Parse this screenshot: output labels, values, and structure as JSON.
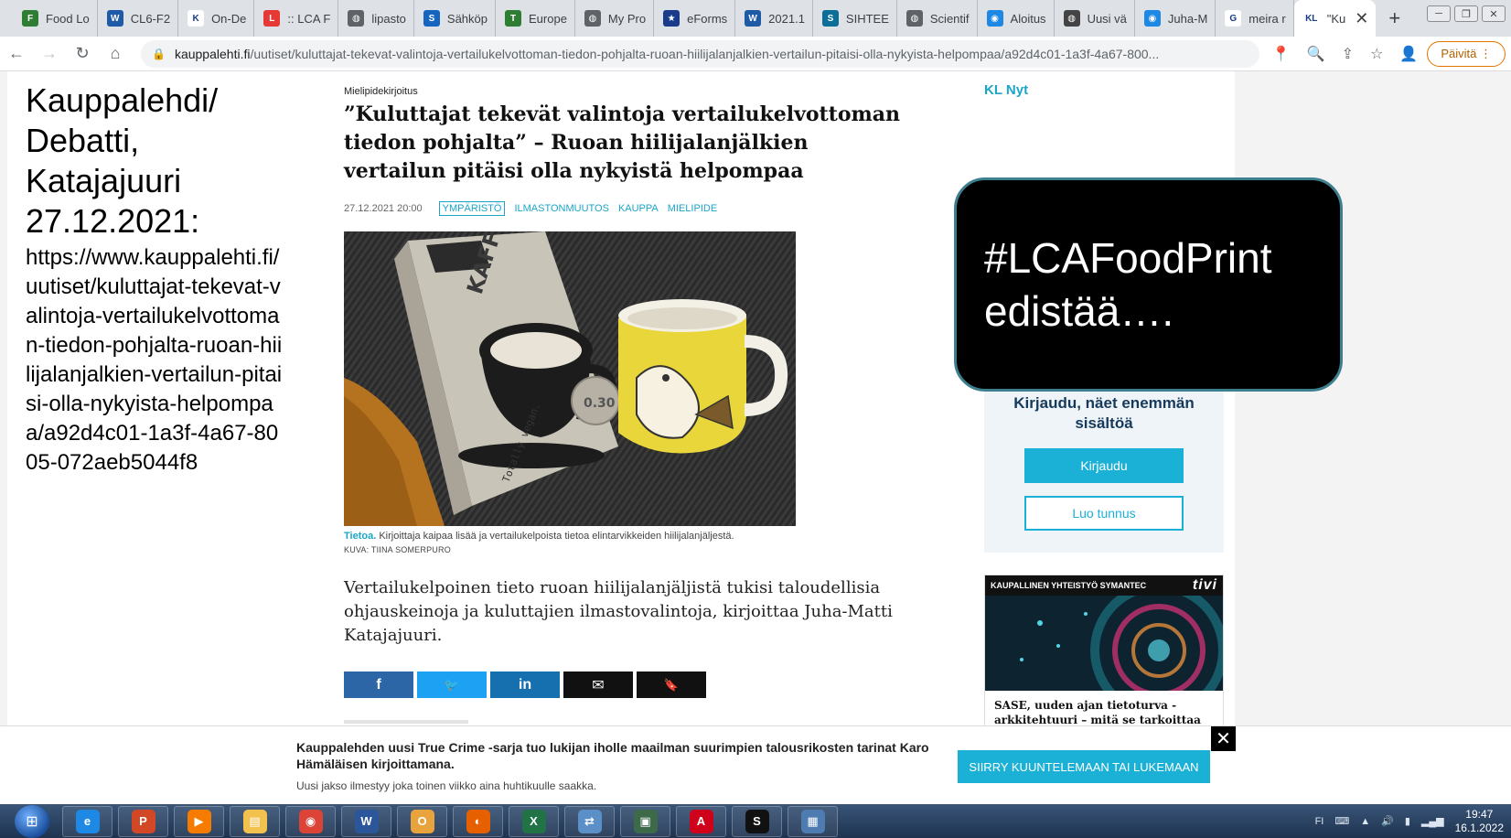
{
  "browser": {
    "tabs": [
      {
        "title": "Food Lo",
        "fav_color": "#2e7d32",
        "fav_text": "F"
      },
      {
        "title": "CL6-F2",
        "fav_color": "#1f5aa6",
        "fav_text": "W"
      },
      {
        "title": "On-De",
        "fav_color": "#ffffff",
        "fav_text": "K"
      },
      {
        "title": ":: LCA F",
        "fav_color": "#e53935",
        "fav_text": "L"
      },
      {
        "title": "lipasto",
        "fav_color": "#5f6368",
        "fav_text": "◍"
      },
      {
        "title": "Sähköp",
        "fav_color": "#1565c0",
        "fav_text": "S"
      },
      {
        "title": "Europe",
        "fav_color": "#2e7d32",
        "fav_text": "T"
      },
      {
        "title": "My Pro",
        "fav_color": "#5f6368",
        "fav_text": "◍"
      },
      {
        "title": "eForms",
        "fav_color": "#1a3b8c",
        "fav_text": "★"
      },
      {
        "title": "2021.1",
        "fav_color": "#1f5aa6",
        "fav_text": "W"
      },
      {
        "title": "SIHTEE",
        "fav_color": "#0b6e99",
        "fav_text": "S"
      },
      {
        "title": "Scientif",
        "fav_color": "#5f6368",
        "fav_text": "◍"
      },
      {
        "title": "Aloitus",
        "fav_color": "#1e88e5",
        "fav_text": "◉"
      },
      {
        "title": "Uusi vä",
        "fav_color": "#444444",
        "fav_text": "◍"
      },
      {
        "title": "Juha-M",
        "fav_color": "#1e88e5",
        "fav_text": "◉"
      },
      {
        "title": "meira r",
        "fav_color": "#ffffff",
        "fav_text": "G"
      },
      {
        "title": "\"Ku",
        "fav_color": "#ffffff",
        "fav_text": "KL",
        "active": true
      }
    ],
    "new_tab": "+",
    "close_tab": "✕",
    "url_host": "kauppalehti.fi",
    "url_path": "/uutiset/kuluttajat-tekevat-valintoja-vertailukelvottoman-tiedon-pohjalta-ruoan-hiilijalanjalkien-vertailun-pitaisi-olla-nykyista-helpompaa/a92d4c01-1a3f-4a67-800...",
    "update_label": "Päivitä"
  },
  "left_panel": {
    "title": "Kauppalehdi/ Debatti, Katajajuuri 27.12.2021:",
    "url": "https://www.kauppalehti.fi/uutiset/kuluttajat-tekevat-valintoja-vertailukelvottoman-tiedon-pohjalta-ruoan-hiilijalanjalkien-vertailun-pitaisi-olla-nykyista-helpompaa/a92d4c01-1a3f-4a67-8005-072aeb5044f8"
  },
  "article": {
    "kicker": "Mielipidekirjoitus",
    "headline": "”Kuluttajat tekevät valintoja vertailukelvottoman tiedon pohjalta” – Ruoan hiilijalanjälkien vertailun pitäisi olla nykyistä helpompaa",
    "date": "27.12.2021 20:00",
    "tags": [
      "YMPÄRISTÖ",
      "ILMASTONMUUTOS",
      "KAUPPA",
      "MIELIPIDE"
    ],
    "carton_text": "KAFFE",
    "carton_small": "Totally vegan.",
    "carton_badge": "0.30",
    "caption_lead": "Tietoa.",
    "caption": "Kirjoittaja kaipaa lisää ja vertailukelpoista tietoa elintarvikkeiden hiilijalanjäljestä.",
    "credit": "KUVA: TIINA SOMERPURO",
    "ingress": "Vertailukelpoinen tieto ruoan hiilijalanjäljistä tukisi taloudellisia ohjauskeinoja ja kuluttajien ilmastovalintoja, kirjoittaa Juha-Matti Katajajuuri.",
    "share": {
      "facebook": "f",
      "twitter": "🐦",
      "linkedin": "in",
      "email": "✉",
      "save": "🔖"
    }
  },
  "sidebar": {
    "kl_nyt": "KL Nyt",
    "login_prompt": "Kirjaudu, näet enemmän sisältöä",
    "login_button": "Kirjaudu",
    "register_button": "Luo tunnus",
    "ad": {
      "label": "KAUPALLINEN YHTEISTYÖ SYMANTEC",
      "brand": "tivi",
      "title": "SASE, uuden ajan tietoturva -arkkitehtuuri – mitä se tarkoittaa"
    }
  },
  "callout": {
    "text": "#LCAFoodPrint edistää…."
  },
  "banner": {
    "text": "Kauppalehden uusi True Crime -sarja tuo lukijan iholle maailman suurimpien talousrikosten tarinat Karo Hämäläisen kirjoittamana.",
    "sub": "Uusi jakso ilmestyy joka toinen viikko aina huhtikuulle saakka.",
    "cta": "SIIRRY KUUNTELEMAAN TAI LUKEMAAN",
    "close": "✕"
  },
  "taskbar": {
    "apps": [
      {
        "name": "internet-explorer",
        "color": "#1e88e5",
        "glyph": "e"
      },
      {
        "name": "powerpoint",
        "color": "#d24726",
        "glyph": "P"
      },
      {
        "name": "media-player",
        "color": "#f57c00",
        "glyph": "▶"
      },
      {
        "name": "file-explorer",
        "color": "#f2c14e",
        "glyph": "▤"
      },
      {
        "name": "chrome",
        "color": "#db4437",
        "glyph": "◉"
      },
      {
        "name": "word",
        "color": "#2b579a",
        "glyph": "W"
      },
      {
        "name": "outlook",
        "color": "#e8a33d",
        "glyph": "O"
      },
      {
        "name": "firefox",
        "color": "#e66000",
        "glyph": "◐"
      },
      {
        "name": "excel",
        "color": "#217346",
        "glyph": "X"
      },
      {
        "name": "remote-tool",
        "color": "#5b8fc7",
        "glyph": "⇄"
      },
      {
        "name": "desktop-app",
        "color": "#3d6b4a",
        "glyph": "▣"
      },
      {
        "name": "acrobat",
        "color": "#d0021b",
        "glyph": "A"
      },
      {
        "name": "skype-business",
        "color": "#111111",
        "glyph": "S"
      },
      {
        "name": "image-viewer",
        "color": "#4f7cb0",
        "glyph": "▦"
      }
    ],
    "language": "FI",
    "time": "19:47",
    "date": "16.1.2022"
  }
}
